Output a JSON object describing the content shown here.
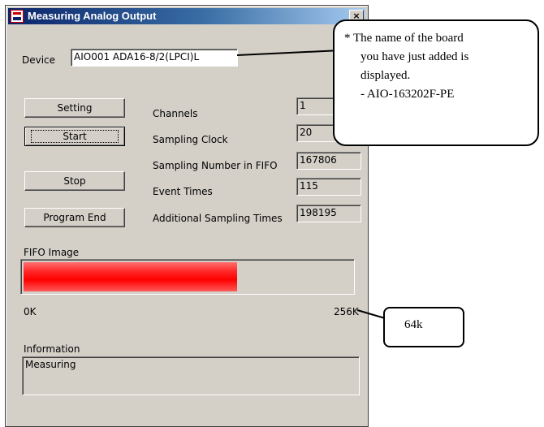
{
  "window": {
    "title": "Measuring Analog Output",
    "close_glyph": "×"
  },
  "device": {
    "label": "Device",
    "value": "AIO001 ADA16-8/2(LPCI)L"
  },
  "buttons": {
    "setting": "Setting",
    "start": "Start",
    "stop": "Stop",
    "program_end": "Program End"
  },
  "fields": [
    {
      "label": "Channels",
      "value": "1"
    },
    {
      "label": "Sampling Clock",
      "value": "20"
    },
    {
      "label": "Sampling Number in FIFO",
      "value": "167806"
    },
    {
      "label": "Event Times",
      "value": "115"
    },
    {
      "label": "Additional Sampling Times",
      "value": "198195"
    }
  ],
  "fifo": {
    "label": "FIFO Image",
    "min_label": "0K",
    "max_label": "256K",
    "fill_fraction": 0.65,
    "fill_color": "#ff0000"
  },
  "information": {
    "label": "Information",
    "text": "Measuring"
  },
  "callouts": {
    "device_note": {
      "line1": "* The name of the board",
      "line2": "you have just added is",
      "line3": "displayed.",
      "line4": "- AIO-163202F-PE"
    },
    "fifo_note": "64k"
  },
  "colors": {
    "titlebar": "#0a246a",
    "dialog_bg": "#d4d0c8"
  }
}
